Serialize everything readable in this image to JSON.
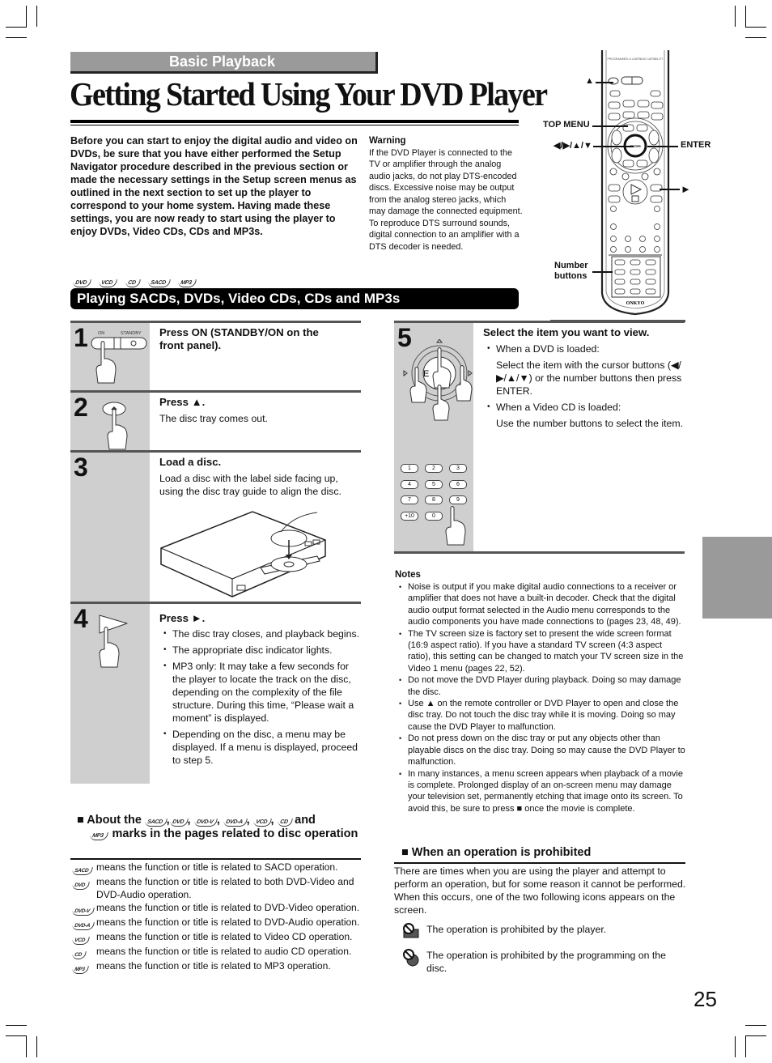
{
  "header": {
    "section_tab": "Basic Playback",
    "page_title": "Getting Started Using Your DVD Player"
  },
  "intro": "Before you can start to enjoy the digital audio and video on DVDs, be sure that you have either performed the Setup Navigator procedure described in the previous section or made the necessary settings in the Setup screen menus as outlined in the next section to set up the player to correspond to your home system. Having made these settings, you are now ready to start using the player to enjoy DVDs, Video CDs, CDs and MP3s.",
  "warning": {
    "title": "Warning",
    "text1": "If the DVD Player is connected to the TV or amplifier through the analog audio jacks, do not play DTS-encoded discs. Excessive noise may be output from the analog stereo jacks, which may damage the connected equipment.",
    "text2": "To reproduce DTS surround sounds, digital connection to an amplifier with a DTS decoder is needed."
  },
  "remote": {
    "labels": {
      "eject": "▲",
      "top_menu": "TOP MENU",
      "cursor": "◀/▶/▲/▼",
      "enter": "ENTER",
      "play": "►",
      "number_buttons_1": "Number",
      "number_buttons_2": "buttons"
    },
    "brand": "ONKYO",
    "key_enter": "ENTER"
  },
  "disc_marks_row": [
    "DVD",
    "VCD",
    "CD",
    "SACD",
    "MP3"
  ],
  "section_bar": "Playing SACDs, DVDs, Video CDs, CDs and MP3s",
  "steps": [
    {
      "num": "1",
      "head": "Press ON (STANDBY/ON on the front panel).",
      "illus": {
        "on": "ON",
        "standby": "STANDBY"
      }
    },
    {
      "num": "2",
      "head": "Press ▲.",
      "text": "The disc tray comes out."
    },
    {
      "num": "3",
      "head": "Load a disc.",
      "text": "Load a disc with the label side facing up, using the disc tray guide to align the disc."
    },
    {
      "num": "4",
      "head": "Press ►.",
      "bullets": [
        "The disc tray closes, and playback begins.",
        "The appropriate disc indicator lights.",
        "MP3 only: It may take a few seconds for the player to locate the track on the disc, depending on the complexity of the file structure. During this time, “Please wait a moment” is displayed.",
        "Depending on the disc, a menu may be displayed. If a menu is displayed, proceed to step 5."
      ]
    },
    {
      "num": "5",
      "head": "Select the item you want to view.",
      "b1": "When a DVD is loaded:",
      "b1_sub": "Select the item with the cursor buttons (◀/▶/▲/▼) or the number buttons then press ENTER.",
      "b2": "When a Video CD is loaded:",
      "b2_sub": "Use the number buttons to select the item.",
      "enter_key": "E",
      "keys": [
        "1",
        "2",
        "3",
        "4",
        "5",
        "6",
        "7",
        "8",
        "9",
        "+10",
        "0"
      ]
    }
  ],
  "notes": {
    "title": "Notes",
    "items": [
      "Noise is output if you make digital audio connections to a receiver or amplifier that does not have a built-in decoder. Check that the digital audio output format selected in the Audio menu corresponds to the audio components you have made connections to (pages 23, 48, 49).",
      "The TV screen size is factory set to present the wide screen format (16:9 aspect ratio). If you have a standard TV screen (4:3 aspect ratio), this setting can be changed to match your TV screen size in the Video 1 menu (pages 22, 52).",
      "Do not move the DVD Player during playback. Doing so may damage the disc.",
      "Use ▲ on the remote controller or DVD Player to open and close the disc tray. Do not touch the disc tray while it is moving. Doing so may cause the DVD Player to malfunction.",
      "Do not press down on the disc tray or put any objects other than playable discs on the disc tray. Doing so may cause the DVD Player to malfunction.",
      "In many instances, a menu screen appears when playback of a movie is complete. Prolonged display of an on-screen menu may damage your television set, permanently etching that image onto its screen. To avoid this, be sure to press ■ once the movie is complete."
    ]
  },
  "about": {
    "prefix": "■ About the",
    "marks": [
      "SACD",
      "DVD",
      "DVD-V",
      "DVD-A",
      "VCD",
      "CD"
    ],
    "and": "and",
    "last_mark": "MP3",
    "suffix": "marks in the pages related to disc operation",
    "rows": [
      {
        "mark": "SACD",
        "text": "means the function or title is related to SACD operation."
      },
      {
        "mark": "DVD",
        "text": "means the function or title is related to both DVD-Video and DVD-Audio operation."
      },
      {
        "mark": "DVD-V",
        "text": "means the function or title is related to DVD-Video operation."
      },
      {
        "mark": "DVD-A",
        "text": "means the function or title is related to DVD-Audio operation."
      },
      {
        "mark": "VCD",
        "text": "means the function or title is related to Video CD operation."
      },
      {
        "mark": "CD",
        "text": "means the function or title is related to audio CD operation."
      },
      {
        "mark": "MP3",
        "text": "means the function or title is related to MP3 operation."
      }
    ]
  },
  "prohibited": {
    "title": "■ When an operation is prohibited",
    "text": "There are times when you are using the player and attempt to perform an operation, but for some reason it cannot be performed. When this occurs, one of the two following icons appears on the screen.",
    "rows": [
      {
        "icon": "prohibited-by-player-icon",
        "text": "The operation is prohibited by the player."
      },
      {
        "icon": "prohibited-by-disc-icon",
        "text": "The operation is prohibited by the programming on the disc."
      }
    ]
  },
  "page_number": "25"
}
